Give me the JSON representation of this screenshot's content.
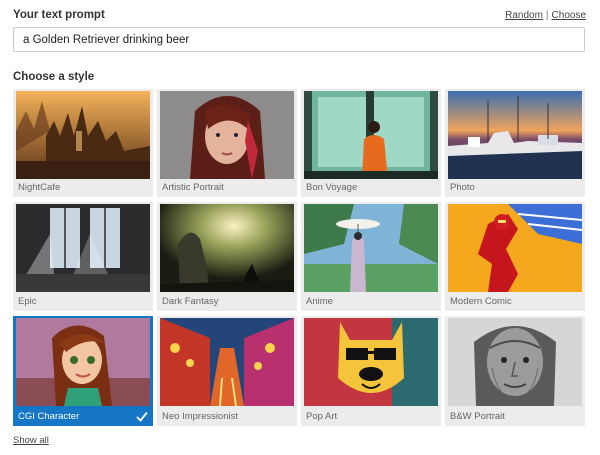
{
  "prompt": {
    "title": "Your text prompt",
    "random_label": "Random",
    "separator": "|",
    "choose_label": "Choose",
    "value": "a Golden Retriever drinking beer"
  },
  "styles": {
    "title": "Choose a style",
    "items": [
      {
        "label": "NightCafe"
      },
      {
        "label": "Artistic Portrait"
      },
      {
        "label": "Bon Voyage"
      },
      {
        "label": "Photo"
      },
      {
        "label": "Epic"
      },
      {
        "label": "Dark Fantasy"
      },
      {
        "label": "Anime"
      },
      {
        "label": "Modern Comic"
      },
      {
        "label": "CGI Character",
        "selected": true
      },
      {
        "label": "Neo Impressionist"
      },
      {
        "label": "Pop Art"
      },
      {
        "label": "B&W Portrait"
      }
    ],
    "selected_index": 8
  },
  "show_all_label": "Show all",
  "colors": {
    "accent": "#1476c5",
    "tile_bg": "#ececec"
  }
}
